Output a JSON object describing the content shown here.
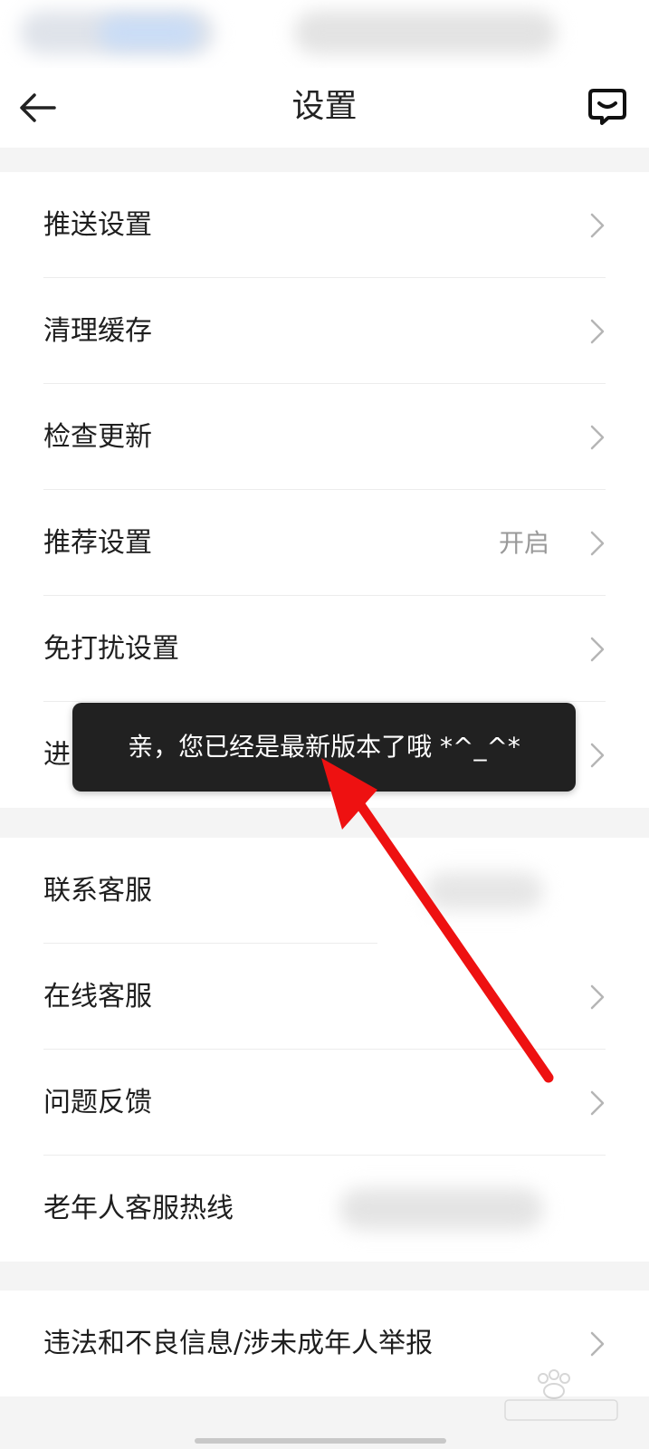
{
  "header": {
    "title": "设置",
    "back_icon": "arrow-left-icon",
    "message_icon": "chat-bubble-icon"
  },
  "group1": {
    "items": [
      {
        "label": "推送设置",
        "value": "",
        "has_chevron": true
      },
      {
        "label": "清理缓存",
        "value": "",
        "has_chevron": true
      },
      {
        "label": "检查更新",
        "value": "",
        "has_chevron": true
      },
      {
        "label": "推荐设置",
        "value": "开启",
        "has_chevron": true
      },
      {
        "label": "免打扰设置",
        "value": "",
        "has_chevron": true
      },
      {
        "label": "进",
        "value": "",
        "has_chevron": true
      }
    ]
  },
  "group2": {
    "items": [
      {
        "label": "联系客服",
        "value": "",
        "has_chevron": false
      },
      {
        "label": "在线客服",
        "value": "",
        "has_chevron": true
      },
      {
        "label": "问题反馈",
        "value": "",
        "has_chevron": true
      },
      {
        "label": "老年人客服热线",
        "value": "",
        "has_chevron": false
      }
    ]
  },
  "group3": {
    "items": [
      {
        "label": "违法和不良信息/涉未成年人举报",
        "value": "",
        "has_chevron": true
      }
    ]
  },
  "toast": {
    "message": "亲，您已经是最新版本了哦 *^_^*"
  },
  "colors": {
    "annotation_arrow": "#ee1111",
    "toast_bg": "#212121"
  }
}
